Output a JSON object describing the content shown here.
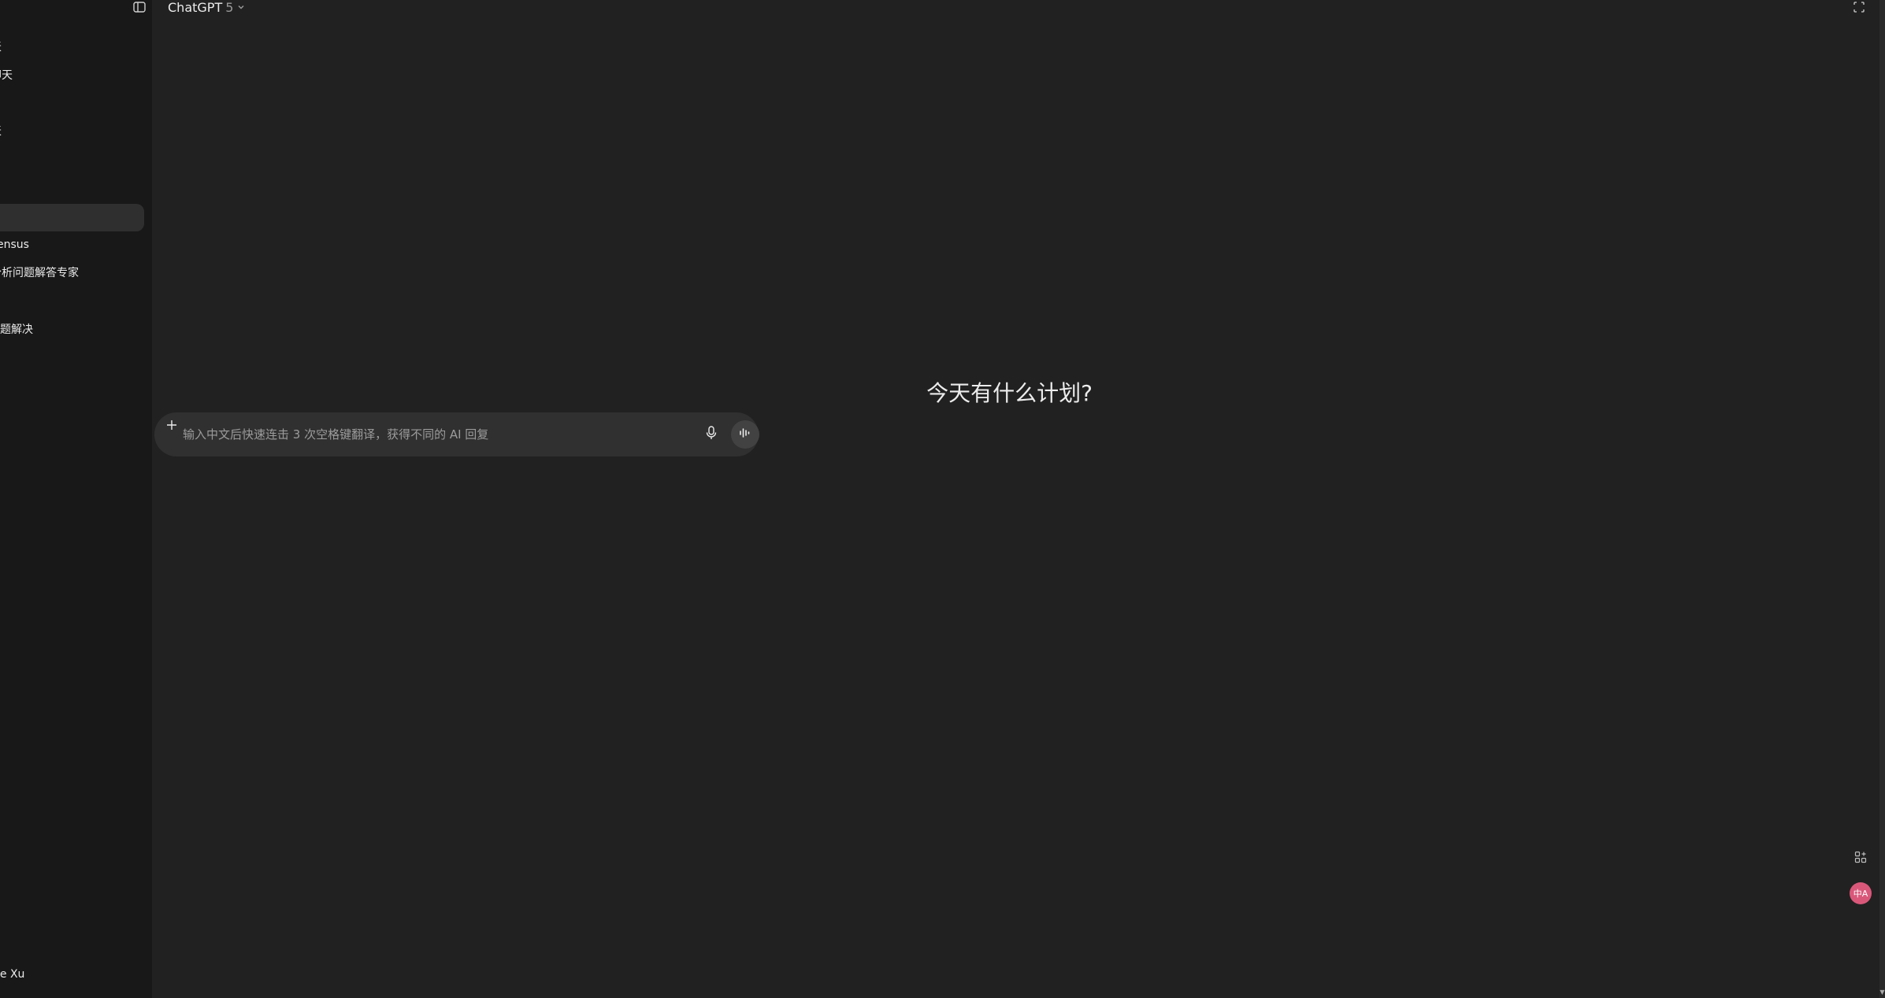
{
  "header": {
    "model_name": "ChatGPT",
    "model_version": "5"
  },
  "sidebar": {
    "items": [
      {
        "label": "天",
        "top": 0
      },
      {
        "label": "聊天"
      },
      {
        "label": "天"
      },
      {
        "label": ""
      },
      {
        "label": "ensus"
      },
      {
        "label": "分析问题解答专家"
      },
      {
        "label": "问题解决"
      }
    ],
    "user_name": "le Xu"
  },
  "main": {
    "headline": "今天有什么计划?"
  },
  "composer": {
    "placeholder": "输入中文后快速连击 3 次空格键翻译，获得不同的 AI 回复"
  },
  "floating": {
    "translate_label": "中A"
  },
  "colors": {
    "background": "#212121",
    "sidebar": "#181818",
    "composer": "#303030",
    "translate_accent": "#d9587a"
  }
}
